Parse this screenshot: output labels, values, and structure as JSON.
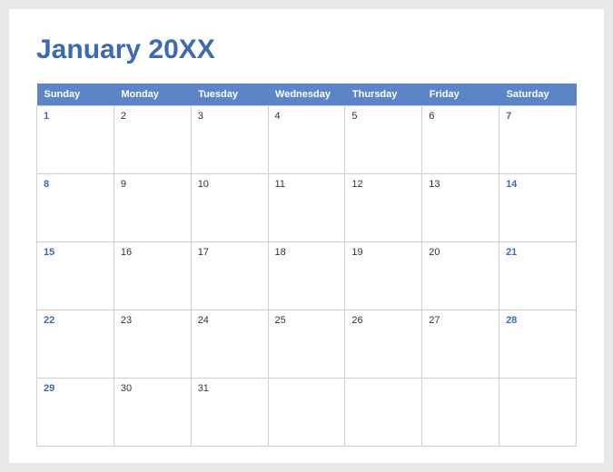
{
  "title": "January 20XX",
  "colors": {
    "accent": "#3a6ab5",
    "header_bg": "#5c85c7"
  },
  "weekdays": [
    "Sunday",
    "Monday",
    "Tuesday",
    "Wednesday",
    "Thursday",
    "Friday",
    "Saturday"
  ],
  "weeks": [
    [
      {
        "n": "1",
        "weekend": true
      },
      {
        "n": "2"
      },
      {
        "n": "3"
      },
      {
        "n": "4"
      },
      {
        "n": "5"
      },
      {
        "n": "6"
      },
      {
        "n": "7",
        "weekend": true
      }
    ],
    [
      {
        "n": "8",
        "weekend": true
      },
      {
        "n": "9"
      },
      {
        "n": "10"
      },
      {
        "n": "11"
      },
      {
        "n": "12"
      },
      {
        "n": "13"
      },
      {
        "n": "14",
        "weekend": true
      }
    ],
    [
      {
        "n": "15",
        "weekend": true
      },
      {
        "n": "16"
      },
      {
        "n": "17"
      },
      {
        "n": "18"
      },
      {
        "n": "19"
      },
      {
        "n": "20"
      },
      {
        "n": "21",
        "weekend": true
      }
    ],
    [
      {
        "n": "22",
        "weekend": true
      },
      {
        "n": "23"
      },
      {
        "n": "24"
      },
      {
        "n": "25"
      },
      {
        "n": "26"
      },
      {
        "n": "27"
      },
      {
        "n": "28",
        "weekend": true
      }
    ],
    [
      {
        "n": "29",
        "weekend": true
      },
      {
        "n": "30"
      },
      {
        "n": "31"
      },
      {
        "n": ""
      },
      {
        "n": ""
      },
      {
        "n": ""
      },
      {
        "n": ""
      }
    ]
  ]
}
